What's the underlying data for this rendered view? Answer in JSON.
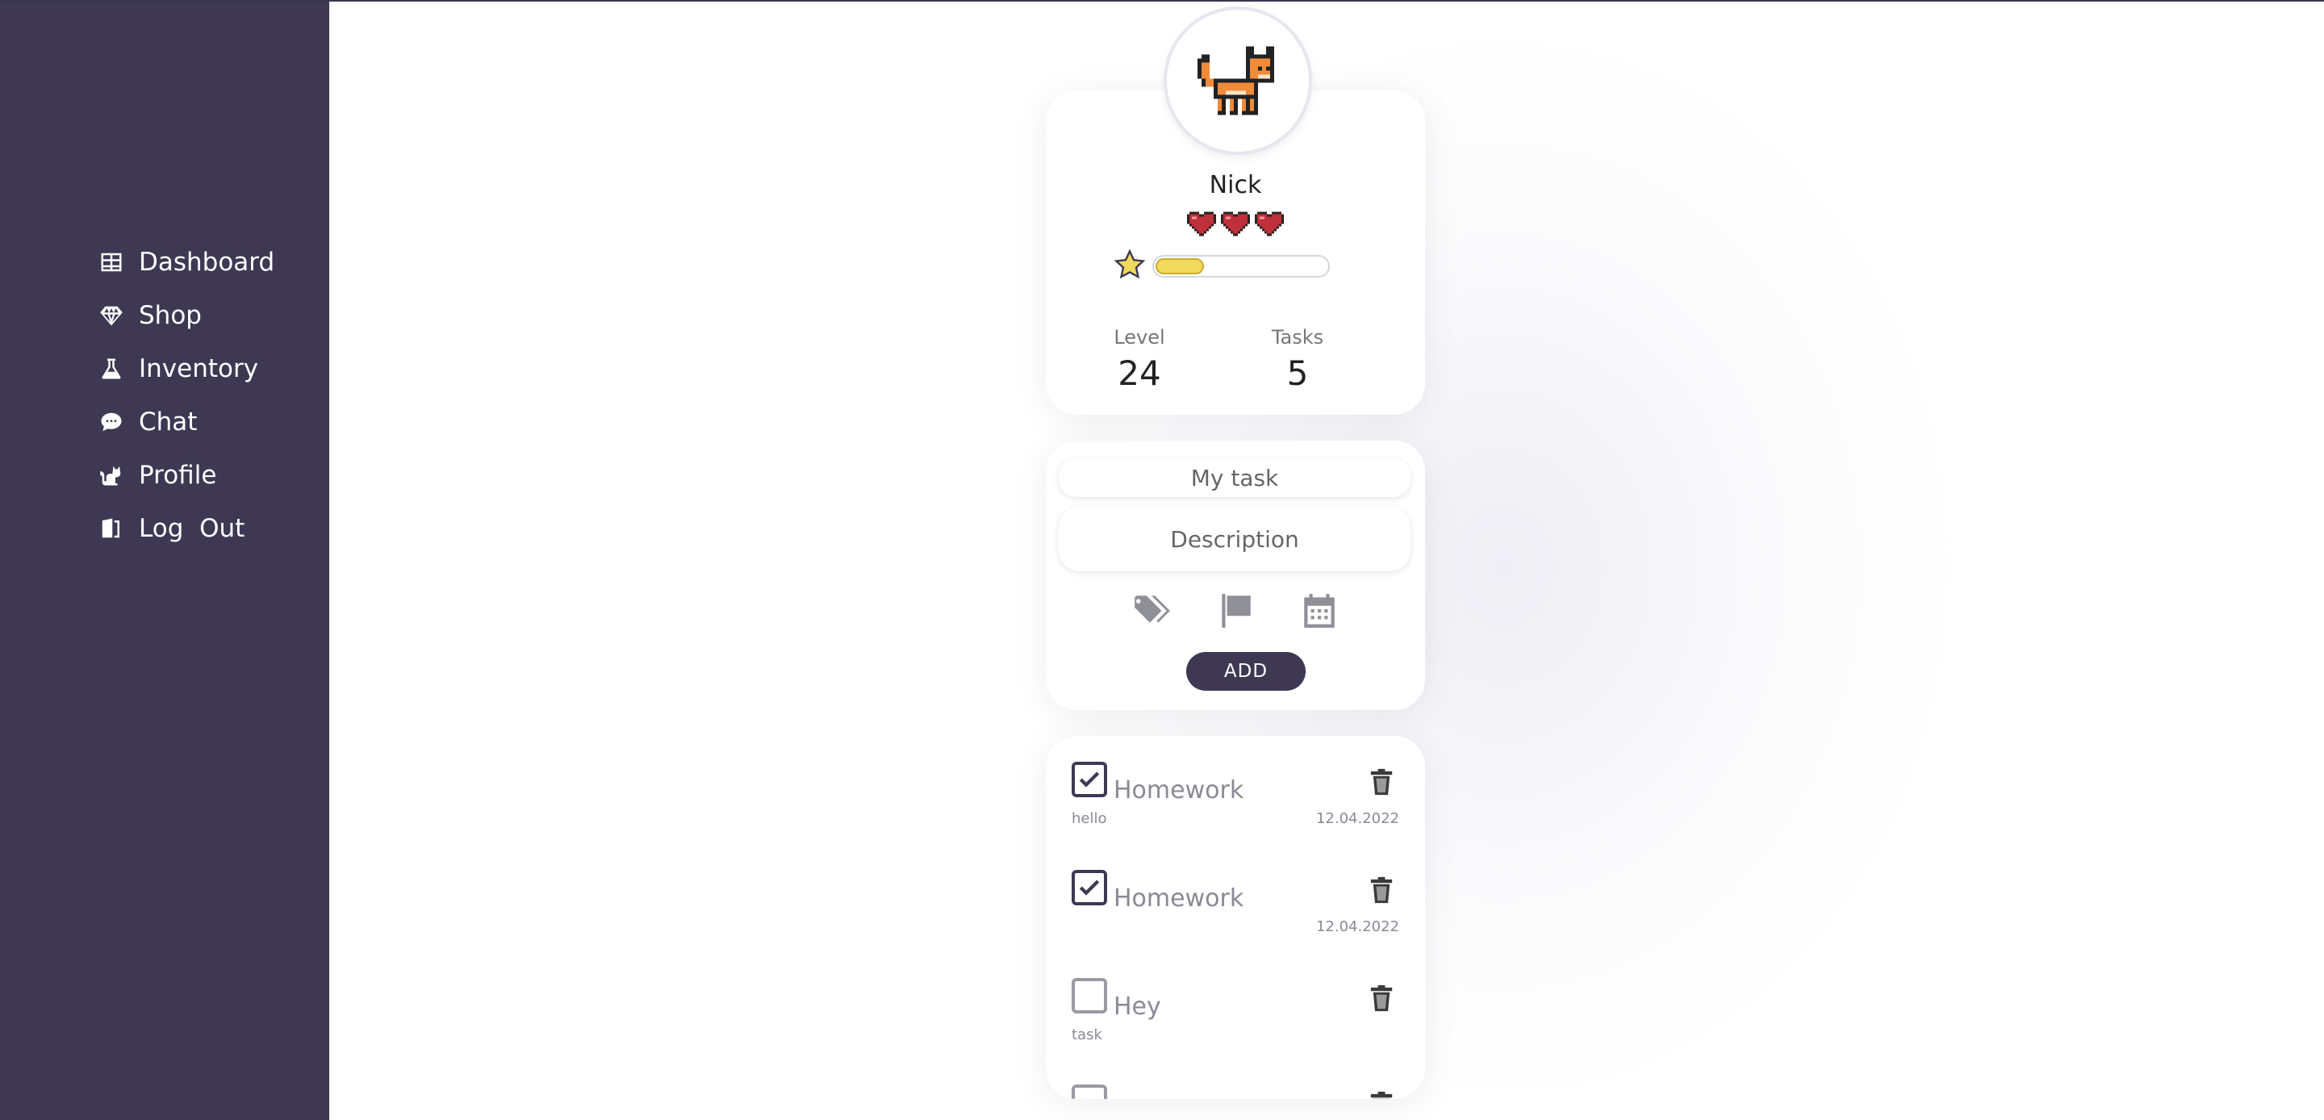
{
  "sidebar": {
    "items": [
      {
        "label": "Dashboard",
        "icon": "table-icon"
      },
      {
        "label": "Shop",
        "icon": "gem-icon"
      },
      {
        "label": "Inventory",
        "icon": "flask-icon"
      },
      {
        "label": "Chat",
        "icon": "chat-bubble-icon"
      },
      {
        "label": "Profile",
        "icon": "cat-icon"
      },
      {
        "label": "Log  Out",
        "icon": "door-exit-icon"
      }
    ]
  },
  "profile": {
    "name": "Nick",
    "avatar": "pixel-fox-icon",
    "hearts": 3,
    "xp_fraction": 0.28,
    "level_label": "Level",
    "level_value": "24",
    "tasks_label": "Tasks",
    "tasks_value": "5"
  },
  "add_task": {
    "title_placeholder": "My task",
    "description_placeholder": "Description",
    "tools": [
      "tags-icon",
      "flag-icon",
      "calendar-icon"
    ],
    "add_label": "ADD"
  },
  "tasks": [
    {
      "title": "Homework",
      "description": "hello",
      "date": "12.04.2022",
      "checked": true
    },
    {
      "title": "Homework",
      "description": "",
      "date": "12.04.2022",
      "checked": true
    },
    {
      "title": "Hey",
      "description": "task",
      "date": "",
      "checked": false
    },
    {
      "title": "",
      "description": "",
      "date": "",
      "checked": false
    }
  ],
  "colors": {
    "sidebar": "#3e3853",
    "accent": "#3e3853",
    "xp": "#f1d95c",
    "heart": "#c0303a"
  }
}
